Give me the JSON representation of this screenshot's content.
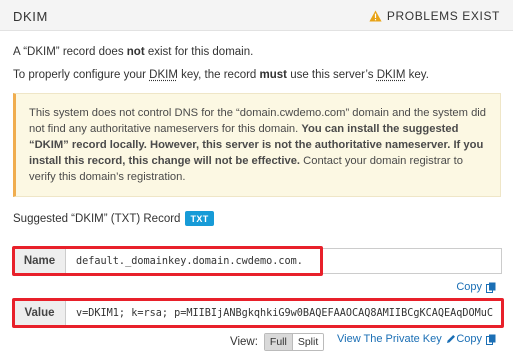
{
  "header": {
    "title": "DKIM",
    "status_label": "PROBLEMS EXIST",
    "status_icon": "warning-triangle-icon",
    "warning_color": "#e8a317"
  },
  "intro": {
    "line1_a": "A “DKIM” record does ",
    "line1_b": "not",
    "line1_c": " exist for this domain.",
    "line2_a": "To properly configure your ",
    "line2_abbr1": "DKIM",
    "line2_b": " key, the record ",
    "line2_c": "must",
    "line2_d": " use this server’s ",
    "line2_abbr2": "DKIM",
    "line2_e": " key."
  },
  "alert": {
    "text_a": "This system does not control DNS for the “domain.cwdemo.com” domain and the system did not find any authoritative nameservers for this domain. ",
    "text_b": "You can install the suggested “DKIM” record locally. However, this server is not the authoritative nameserver. If you install this record, this change will not be effective.",
    "text_c": " Contact your domain registrar to verify this domain’s registration."
  },
  "suggested": {
    "label": "Suggested “DKIM” (TXT) Record",
    "badge": "TXT"
  },
  "record": {
    "name_label": "Name",
    "name_value": "default._domainkey.domain.cwdemo.com.",
    "value_label": "Value",
    "value_value": "v=DKIM1; k=rsa; p=MIIBIjANBgkqhkiG9w0BAQEFAAOCAQ8AMIIBCgKCAQEAqDOMuC"
  },
  "actions": {
    "copy_label": "Copy",
    "copy_icon": "copy-icon",
    "view_label": "View:",
    "view_options": [
      "Full",
      "Split"
    ],
    "view_selected": "Full",
    "private_key_label": "View The Private Key",
    "private_key_icon": "pencil-icon",
    "link_color": "#1b6fb5"
  },
  "highlight_color": "#e8202a"
}
